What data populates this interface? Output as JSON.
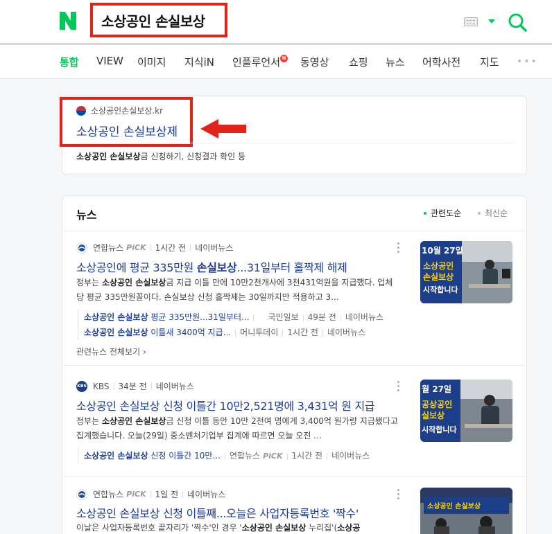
{
  "header": {
    "logo": "N",
    "query": "소상공인 손실보상",
    "icons": {
      "keyboard": "keyboard-icon",
      "dropdown": "chevron-down-icon",
      "search": "search-icon"
    },
    "accent_color": "#03c75a",
    "highlight_color": "#e2231a"
  },
  "tabs": [
    {
      "label": "통합",
      "active": true
    },
    {
      "label": "VIEW"
    },
    {
      "label": "이미지"
    },
    {
      "label": "지식iN"
    },
    {
      "label": "인플루언서",
      "badge": "N"
    },
    {
      "label": "동영상"
    },
    {
      "label": "쇼핑"
    },
    {
      "label": "뉴스"
    },
    {
      "label": "어학사전"
    },
    {
      "label": "지도"
    }
  ],
  "site": {
    "source": "소상공인손실보상.kr",
    "title": "소상공인 손실보상제",
    "desc_bold": "소상공인 손실보상",
    "desc_rest": "금 신청하기, 신청결과 확인 등"
  },
  "news": {
    "heading": "뉴스",
    "sort_relevance": "관련도순",
    "sort_latest": "최신순",
    "items": [
      {
        "press": "연합뉴스",
        "pick": "PiCK",
        "time": "1시간 전",
        "portal": "네이버뉴스",
        "title_bold": "소상공인",
        "title_mid": "에 평균 335만원 ",
        "title_bold2": "손실보상",
        "title_rest": "...31일부터 홀짝제 해제",
        "desc_1": "정부는 ",
        "desc_b1": "소상공인 손실보상",
        "desc_2": "금 지급 이틀 만에 10만2천개사에 3천431억원을 지급했다. 업체당 평균 335만원꼴이다. 손실보상 신청 홀짝제는 30일까지만 적용하고 3...",
        "related": [
          {
            "bold": "소상공인 손실보상",
            "rest": " 평균 335만원...31일부터...",
            "press": "국민일보",
            "time": "49분 전",
            "portal": "네이버뉴스"
          },
          {
            "bold": "소상공인 손실보상",
            "rest": " 이틀새 3400억 지급...",
            "press": "머니투데이",
            "time": "1시간 전",
            "portal": "네이버뉴스"
          }
        ],
        "all_link": "관련뉴스 전체보기 ›"
      },
      {
        "press": "KBS",
        "time": "34분 전",
        "portal": "네이버뉴스",
        "title_bold": "소상공인 손실보상",
        "title_rest": " 신청 이틀간 10만2,521명에 3,431억 원 지급",
        "desc_1": "정부는 ",
        "desc_b1": "소상공인 손실보상",
        "desc_2": "금 신청 이틀 동안 10만 2천여 명에게 3,400억 원가량 지급됐다고 집계했습니다. 오늘(29일) 중소벤처기업부 집계에 따르면 오늘 오전 ...",
        "related": [
          {
            "bold": "소상공인 손실보상",
            "rest": " 신청 이틀간 10만...",
            "press": "연합뉴스",
            "pick": "PiCK",
            "time": "1시간 전",
            "portal": "네이버뉴스"
          }
        ]
      },
      {
        "press": "연합뉴스",
        "pick": "PiCK",
        "time": "1일 전",
        "portal": "네이버뉴스",
        "title_bold": "소상공인 손실보상",
        "title_rest": " 신청 이틀째...오늘은 사업자등록번호 '짝수'",
        "desc_1": "이날은 사업자등록번호 끝자리가 '짝수'인 경우 '",
        "desc_b1": "소상공인 손실보상",
        "desc_2": " 누리집'(",
        "desc_b2": "소상공"
      }
    ]
  }
}
